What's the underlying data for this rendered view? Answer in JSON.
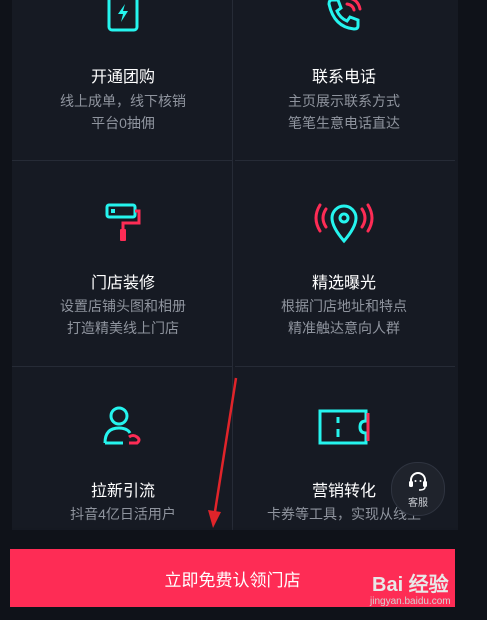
{
  "features": [
    {
      "icon": "phone-bolt-icon",
      "title": "开通团购",
      "desc1": "线上成单，线下核销",
      "desc2": "平台0抽佣"
    },
    {
      "icon": "phone-call-icon",
      "title": "联系电话",
      "desc1": "主页展示联系方式",
      "desc2": "笔笔生意电话直达"
    },
    {
      "icon": "paint-roller-icon",
      "title": "门店装修",
      "desc1": "设置店铺头图和相册",
      "desc2": "打造精美线上门店"
    },
    {
      "icon": "location-signal-icon",
      "title": "精选曝光",
      "desc1": "根据门店地址和特点",
      "desc2": "精准触达意向人群"
    },
    {
      "icon": "user-new-icon",
      "title": "拉新引流",
      "desc1": "抖音4亿日活用户",
      "desc2": ""
    },
    {
      "icon": "ticket-icon",
      "title": "营销转化",
      "desc1": "卡券等工具，实现从线上",
      "desc2": ""
    }
  ],
  "customer_service": {
    "label": "客服"
  },
  "cta": {
    "label": "立即免费认领门店"
  },
  "watermark": {
    "brand": "Bai 经验",
    "url": "jingyan.baidu.com"
  },
  "colors": {
    "accent": "#fe2c55",
    "cyan": "#25f4ee",
    "background": "#161a23"
  }
}
